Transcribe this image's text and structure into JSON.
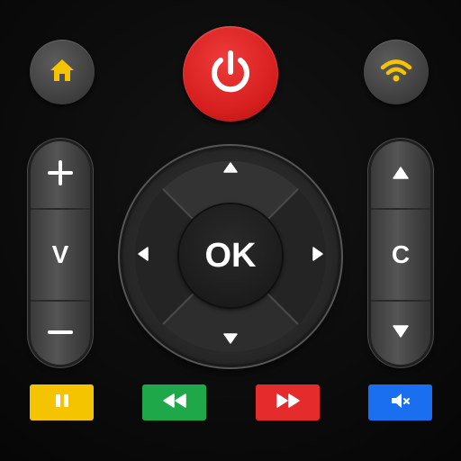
{
  "top_row": {
    "home_icon": "home-icon",
    "power_icon": "power-icon",
    "wifi_icon": "wifi-icon"
  },
  "volume_rocker": {
    "up_icon": "plus-icon",
    "label": "V",
    "down_icon": "minus-icon"
  },
  "channel_rocker": {
    "up_icon": "triangle-up-icon",
    "label": "C",
    "down_icon": "triangle-down-icon"
  },
  "dpad": {
    "ok_label": "OK",
    "up_icon": "arrow-up-icon",
    "down_icon": "arrow-down-icon",
    "left_icon": "arrow-left-icon",
    "right_icon": "arrow-right-icon"
  },
  "media_buttons": [
    {
      "name": "pause",
      "icon": "pause-icon",
      "color": "#f5c400"
    },
    {
      "name": "rewind",
      "icon": "rewind-icon",
      "color": "#1fa84a"
    },
    {
      "name": "fast-forward",
      "icon": "fast-forward-icon",
      "color": "#e52b2b"
    },
    {
      "name": "mute",
      "icon": "mute-icon",
      "color": "#1a6ff0"
    }
  ],
  "colors": {
    "home_icon": "#f5c400",
    "wifi_icon": "#f5c400",
    "power_button": "#d61e1e",
    "background": "#0b0b0b"
  }
}
